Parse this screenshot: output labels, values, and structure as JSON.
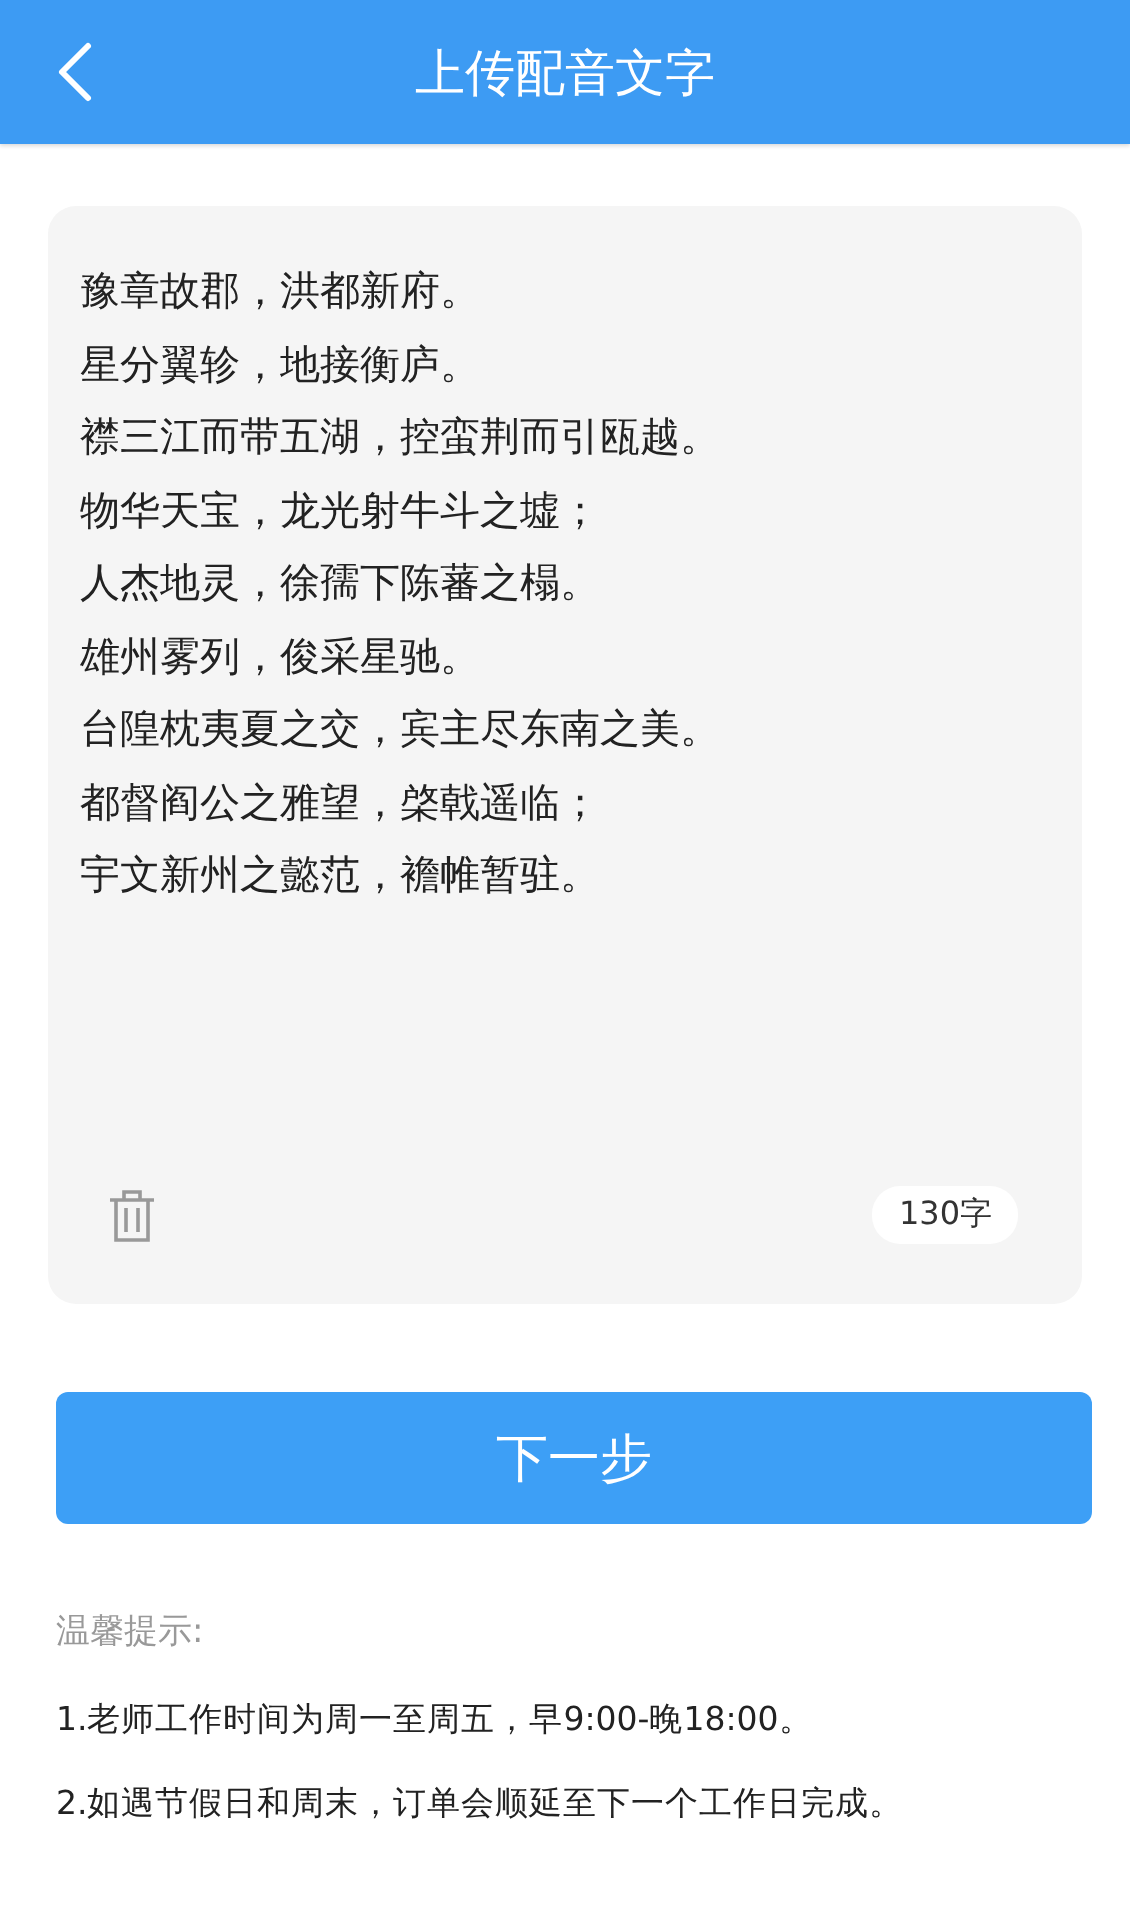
{
  "header": {
    "title": "上传配音文字"
  },
  "editor": {
    "lines": [
      "豫章故郡，洪都新府。",
      "星分翼轸，地接衡庐。",
      "襟三江而带五湖，控蛮荆而引瓯越。",
      "物华天宝，龙光射牛斗之墟；",
      "人杰地灵，徐孺下陈蕃之榻。",
      "雄州雾列，俊采星驰。",
      "台隍枕夷夏之交，宾主尽东南之美。",
      "都督阎公之雅望，棨戟遥临；",
      "宇文新州之懿范，襜帷暂驻。"
    ],
    "count": "130字"
  },
  "next_button": "下一步",
  "tips": {
    "title": "温馨提示:",
    "items": [
      "1.老师工作时间为周一至周五，早9:00-晚18:00。",
      "2.如遇节假日和周末，订单会顺延至下一个工作日完成。"
    ]
  }
}
